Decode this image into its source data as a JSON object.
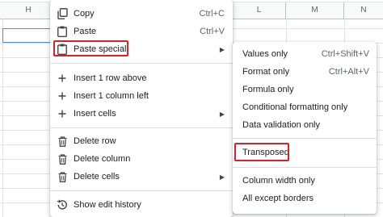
{
  "sheet": {
    "columns_left": [
      "H"
    ],
    "columns_right": [
      "L",
      "M",
      "N"
    ]
  },
  "context_menu": {
    "items": [
      {
        "label": "Copy",
        "shortcut": "Ctrl+C",
        "icon": "copy-icon"
      },
      {
        "label": "Paste",
        "shortcut": "Ctrl+V",
        "icon": "paste-icon"
      },
      {
        "label": "Paste special",
        "icon": "paste-special-icon"
      },
      {
        "label": "Insert 1 row above",
        "icon": "plus-icon"
      },
      {
        "label": "Insert 1 column left",
        "icon": "plus-icon"
      },
      {
        "label": "Insert cells",
        "icon": "plus-icon"
      },
      {
        "label": "Delete row",
        "icon": "trash-icon"
      },
      {
        "label": "Delete column",
        "icon": "trash-icon"
      },
      {
        "label": "Delete cells",
        "icon": "trash-icon"
      },
      {
        "label": "Show edit history",
        "icon": "history-icon"
      }
    ]
  },
  "submenu": {
    "items": [
      {
        "label": "Values only",
        "shortcut": "Ctrl+Shift+V"
      },
      {
        "label": "Format only",
        "shortcut": "Ctrl+Alt+V"
      },
      {
        "label": "Formula only"
      },
      {
        "label": "Conditional formatting only"
      },
      {
        "label": "Data validation only"
      },
      {
        "label": "Transposed"
      },
      {
        "label": "Column width only"
      },
      {
        "label": "All except borders"
      }
    ]
  },
  "colors": {
    "highlight_border": "#d6232b",
    "selection_border": "#4a8af4"
  }
}
